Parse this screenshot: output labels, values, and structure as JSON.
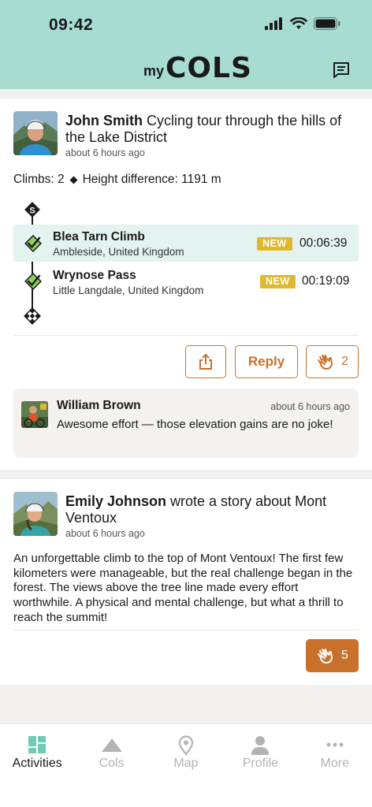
{
  "status_bar": {
    "time": "09:42"
  },
  "header": {
    "logo_prefix": "my",
    "logo_main": "COLS",
    "messages_icon": "chat-icon"
  },
  "feed": {
    "post1": {
      "author": "John Smith",
      "action": " Cycling tour through the hills of the Lake District",
      "time": "about 6 hours ago",
      "stats_climbs": "Climbs: 2",
      "stats_height": "Height difference: 1191 m",
      "climbs": [
        {
          "name": "Blea Tarn Climb",
          "location": "Ambleside, United Kingdom",
          "badge": "NEW",
          "time": "00:06:39"
        },
        {
          "name": "Wrynose Pass",
          "location": "Little Langdale, United Kingdom",
          "badge": "NEW",
          "time": "00:19:09"
        }
      ],
      "start_marker": "S",
      "actions": {
        "reply": "Reply",
        "kudos_count": "2"
      },
      "comment": {
        "author": "William Brown",
        "time": "about 6 hours ago",
        "text": "Awesome effort — those elevation gains are no joke!"
      }
    },
    "post2": {
      "author": "Emily Johnson",
      "action": " wrote a story about Mont Ventoux",
      "time": "about 6 hours ago",
      "text": "An unforgettable climb to the top of Mont Ventoux! The first few kilometers were manageable, but the real challenge began in the forest. The views above the tree line made every effort worthwhile. A physical and mental challenge, but what a thrill to reach the summit!",
      "kudos_count": "5"
    }
  },
  "bottom_nav": [
    {
      "label": "Activities",
      "active": true
    },
    {
      "label": "Cols",
      "active": false
    },
    {
      "label": "Map",
      "active": false
    },
    {
      "label": "Profile",
      "active": false
    },
    {
      "label": "More",
      "active": false
    }
  ],
  "colors": {
    "header_bg": "#a7dcd0",
    "accent": "#c9712b",
    "badge": "#e1b82d",
    "check_green": "#8ccf5a",
    "active_tab": "#6fcab6"
  }
}
